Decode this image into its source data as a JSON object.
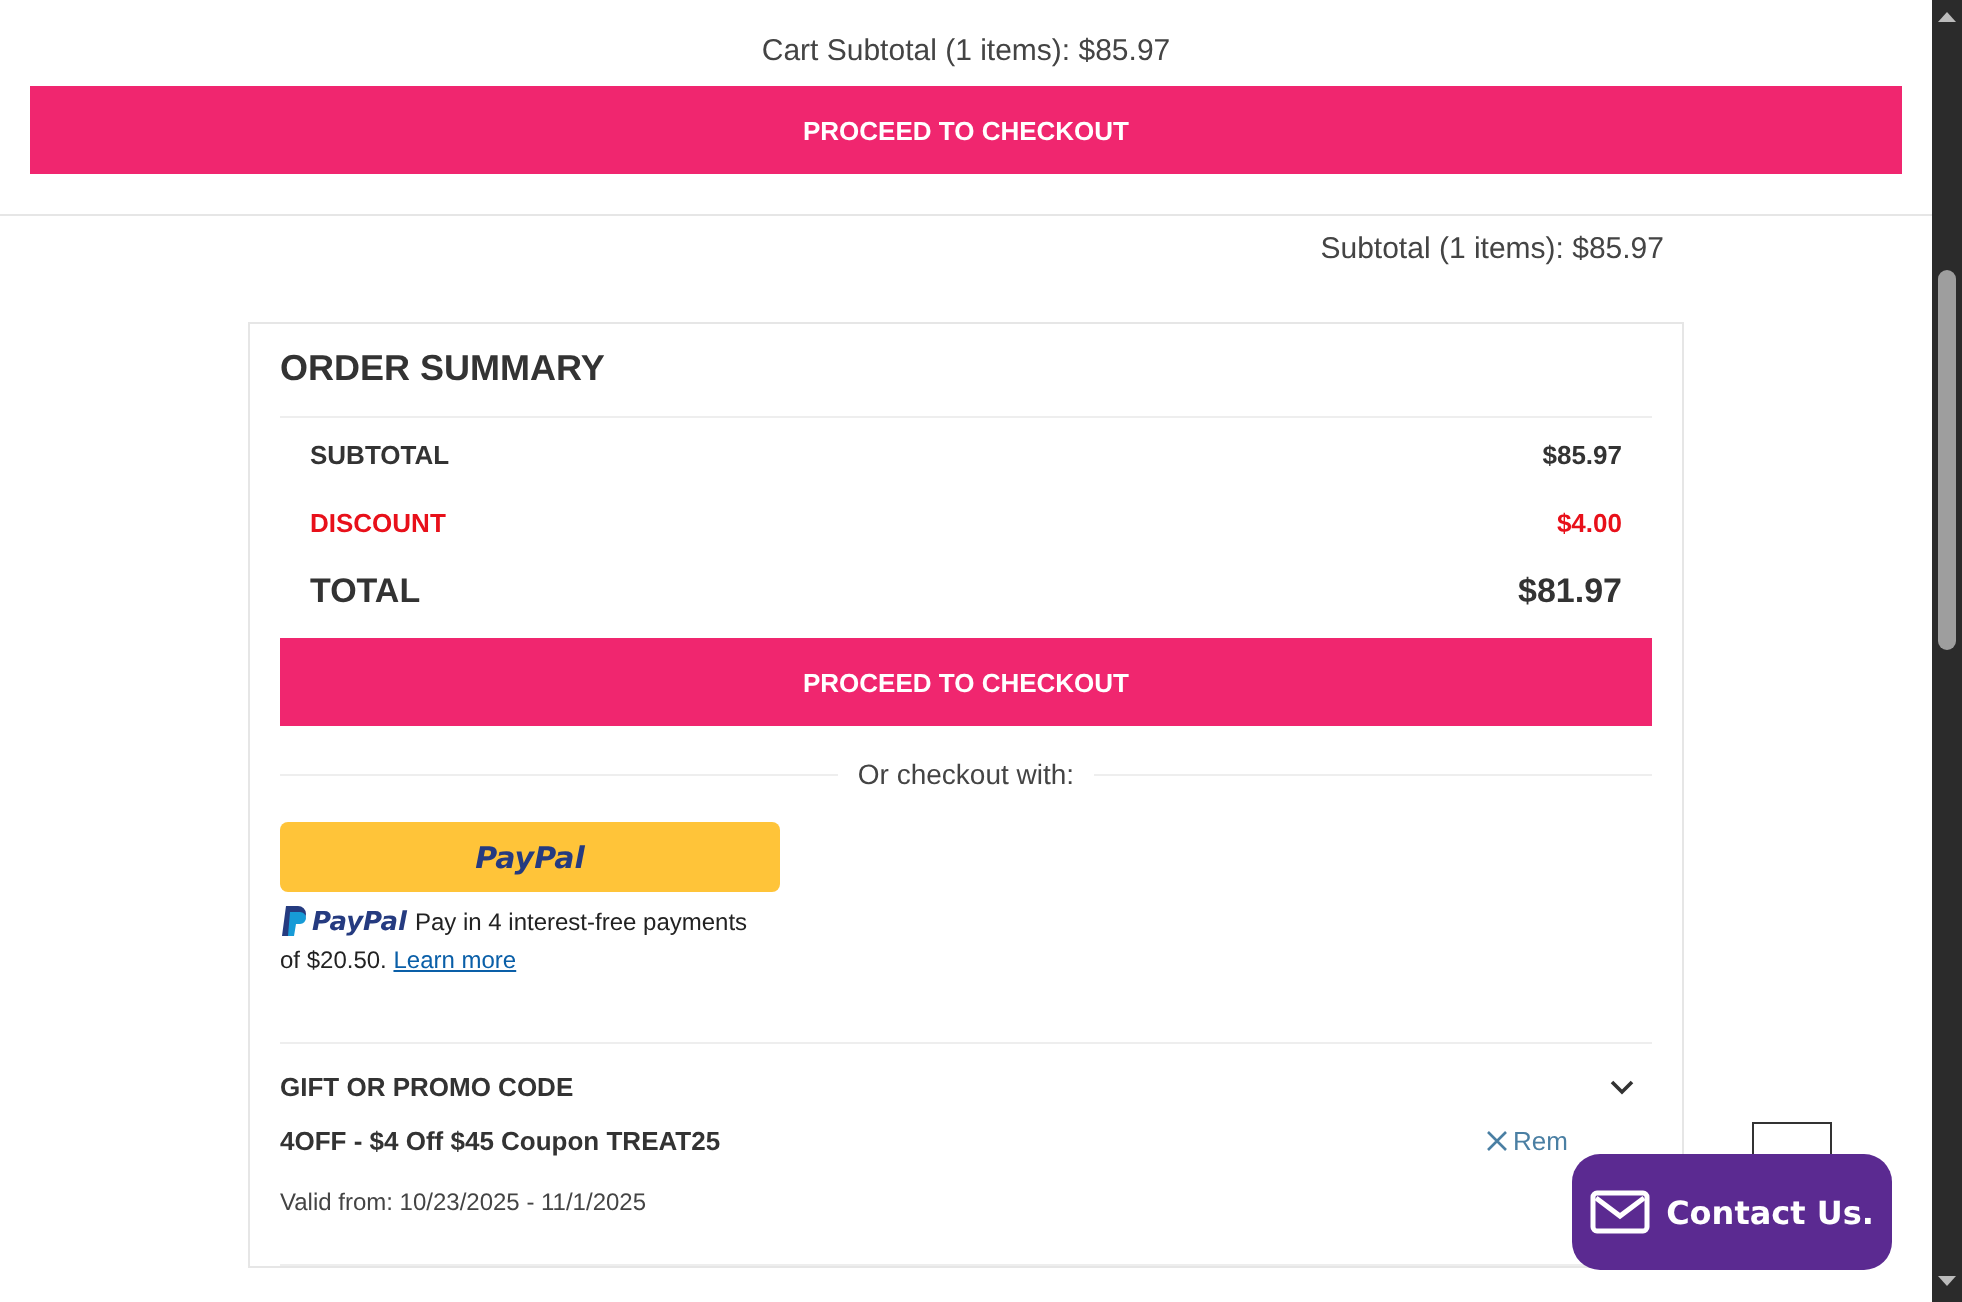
{
  "cart_header": {
    "subtotal": "Cart Subtotal (1 items): $85.97",
    "checkout_button": "PROCEED TO CHECKOUT"
  },
  "subtotal_line": "Subtotal (1 items): $85.97",
  "order_summary": {
    "title": "ORDER SUMMARY",
    "rows": [
      {
        "kind": "normal",
        "label": "SUBTOTAL",
        "value": "$85.97"
      },
      {
        "kind": "discount",
        "label": "DISCOUNT",
        "value": "$4.00"
      },
      {
        "kind": "total",
        "label": "TOTAL",
        "value": "$81.97"
      }
    ],
    "checkout_button": "PROCEED TO CHECKOUT",
    "alt_checkout_label": "Or checkout with:",
    "paypal": {
      "button": "PayPal",
      "brand": "PayPal",
      "message": "Pay in 4 interest-free payments",
      "message_2": "of $20.50.",
      "link": "Learn more"
    },
    "promo": {
      "title": "GIFT OR PROMO CODE",
      "expanded": true,
      "coupon": "4OFF - $4 Off $45 Coupon TREAT25",
      "remove_link": "Rem",
      "valid": "Valid from: 10/23/2025 - 11/1/2025"
    }
  },
  "contact_button": "Contact Us."
}
